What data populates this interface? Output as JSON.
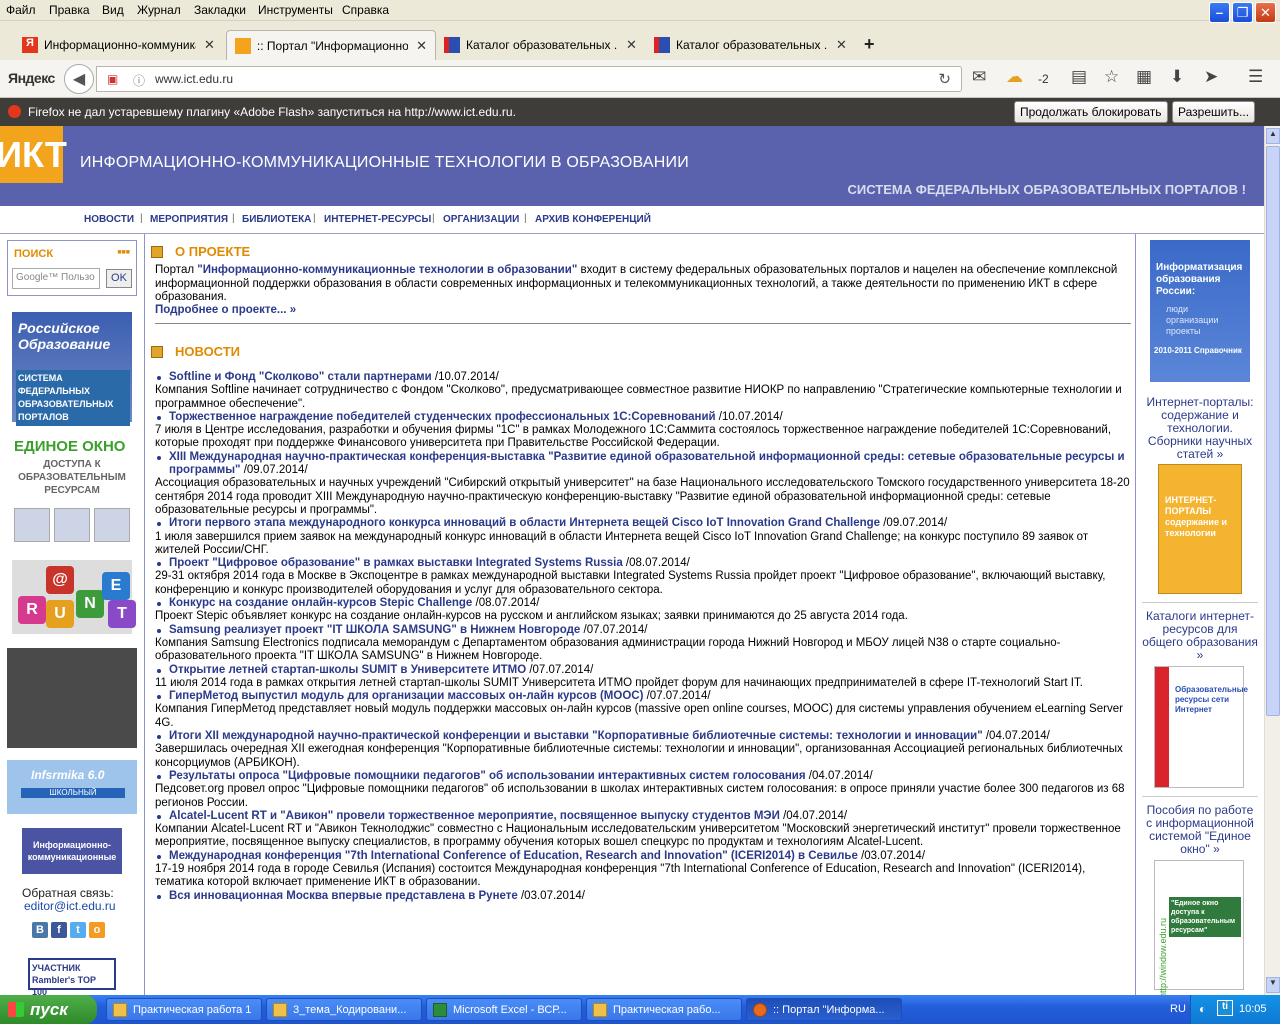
{
  "menubar": [
    "Файл",
    "Правка",
    "Вид",
    "Журнал",
    "Закладки",
    "Инструменты",
    "Справка"
  ],
  "tabs": [
    {
      "title": "Информационно-коммуника...",
      "active": false
    },
    {
      "title": ":: Портал \"Информационно-...",
      "active": true
    },
    {
      "title": "Каталог образовательных ...",
      "active": false
    },
    {
      "title": "Каталог образовательных ...",
      "active": false
    }
  ],
  "navbar": {
    "brand": "Яндекс",
    "url": "www.ict.edu.ru",
    "weather": "-2"
  },
  "notification": {
    "text": "Firefox не дал устаревшему плагину «Adobe Flash» запуститься на http://www.ict.edu.ru.",
    "block_label": "Продолжать блокировать",
    "allow_label": "Разрешить..."
  },
  "site": {
    "logo": "ИКТ",
    "title": "ИНФОРМАЦИОННО-КОММУНИКАЦИОННЫЕ ТЕХНОЛОГИИ В ОБРАЗОВАНИИ",
    "subtitle": "СИСТЕМА ФЕДЕРАЛЬНЫХ ОБРАЗОВАТЕЛЬНЫХ ПОРТАЛОВ !",
    "nav": [
      "НОВОСТИ",
      "МЕРОПРИЯТИЯ",
      "БИБЛИОТЕКА",
      "ИНТЕРНЕТ-РЕСУРСЫ",
      "ОРГАНИЗАЦИИ",
      "АРХИВ КОНФЕРЕНЦИЙ"
    ]
  },
  "left": {
    "search_label": "ПОИСК",
    "search_placeholder": "Google™ Пользо",
    "ok_label": "OK",
    "ro_title": "Российское Образование",
    "ro_sub": "СИСТЕМА ФЕДЕРАЛЬНЫХ ОБРАЗОВАТЕЛЬНЫХ ПОРТАЛОВ",
    "eo_title": "ЕДИНОЕ ОКНО",
    "eo_sub": "ДОСТУПА К ОБРАЗОВАТЕЛЬНЫМ РЕСУРСАМ",
    "runet": [
      "R",
      "U",
      "N",
      "E",
      "T",
      "@"
    ],
    "inf_title": "Infsrmika 6.0",
    "inf_sub": "ШКОЛЬНЫЙ",
    "ikt_banner": "Информационно-коммуникационные",
    "feedback_label": "Обратная связь:",
    "feedback_email": "editor@ict.edu.ru",
    "social": [
      "В",
      "f",
      "t",
      "o"
    ],
    "rambler": "УЧАСТНИК Rambler's TOP 100"
  },
  "about": {
    "heading": "О ПРОЕКТЕ",
    "pre": "Портал ",
    "link": "\"Информационно-коммуникационные технологии в образовании\"",
    "post": " входит в систему федеральных образовательных порталов и нацелен на обеспечение комплексной информационной поддержки образования в области современных информационных и телекоммуникационных технологий, а также деятельности по применению ИКТ в сфере образования.",
    "more": "Подробнее о проекте... »"
  },
  "news_heading": "НОВОСТИ",
  "news": [
    {
      "title": "Softline и Фонд \"Сколково\" стали партнерами",
      "date": " /10.07.2014/",
      "desc": "Компания Softline начинает сотрудничество с Фондом \"Сколково\", предусматривающее совместное развитие НИОКР по направлению \"Стратегические компьютерные технологии и программное обеспечение\"."
    },
    {
      "title": "Торжественное награждение победителей студенческих профессиональных 1С:Соревнований",
      "date": " /10.07.2014/",
      "desc": "7 июля в Центре исследования, разработки и обучения фирмы \"1С\" в рамках Молодежного 1С:Саммита состоялось торжественное награждение победителей 1С:Соревнований, которые проходят при поддержке Финансового университета при Правительстве Российской Федерации."
    },
    {
      "title": "XIII Международная научно-практическая конференция-выставка \"Развитие единой образовательной информационной среды: сетевые образовательные ресурсы и программы\"",
      "date": " /09.07.2014/",
      "desc": "Ассоциация образовательных и научных учреждений \"Сибирский открытый университет\" на базе Национального исследовательского Томского государственного университета 18-20 сентября 2014 года проводит XIII Международную научно-практическую конференцию-выставку \"Развитие единой образовательной информационной среды: сетевые образовательные ресурсы и программы\"."
    },
    {
      "title": "Итоги первого этапа международного конкурса инноваций в области Интернета вещей Cisco IoT Innovation Grand Challenge",
      "date": " /09.07.2014/",
      "desc": "1 июля завершился прием заявок на международный конкурс инноваций в области Интернета вещей Cisco IoT Innovation Grand Challenge; на конкурс поступило 89 заявок от жителей России/СНГ."
    },
    {
      "title": "Проект \"Цифровое образование\" в рамках выставки Integrated Systems Russia",
      "date": " /08.07.2014/",
      "desc": "29-31 октября 2014 года в Москве в Экспоцентре в рамках международной выставки Integrated Systems Russia пройдет проект \"Цифровое образование\", включающий выставку, конференцию и конкурс производителей оборудования и услуг для образовательного сектора."
    },
    {
      "title": "Конкурс на создание онлайн-курсов Stepic Challenge",
      "date": " /08.07.2014/",
      "desc": "Проект Stepic объявляет конкурс на создание онлайн-курсов на русском и английском языках; заявки принимаются до 25 августа 2014 года."
    },
    {
      "title": "Samsung реализует проект \"IT ШКОЛА SAMSUNG\" в Нижнем Новгороде",
      "date": " /07.07.2014/",
      "desc": "Компания Samsung Electronics подписала меморандум с Департаментом образования администрации города Нижний Новгород и МБОУ лицей N38 о старте социально-образовательного проекта \"IT ШКОЛА SAMSUNG\" в Нижнем Новгороде."
    },
    {
      "title": "Открытие летней стартап-школы SUMIT в Университете ИТМО",
      "date": " /07.07.2014/",
      "desc": "11 июля 2014 года в рамках открытия летней стартап-школы SUMIT Университета ИТМО пройдет форум для начинающих предпринимателей в сфере IT-технологий Start IT."
    },
    {
      "title": "ГиперМетод выпустил модуль для организации массовых он-лайн курсов (MOOC)",
      "date": " /07.07.2014/",
      "desc": "Компания ГиперМетод представляет новый модуль поддержки массовых он-лайн курсов (massive open online courses, MOOC) для системы управления обучением eLearning Server 4G."
    },
    {
      "title": "Итоги XII международной научно-практической конференции и выставки \"Корпоративные библиотечные системы: технологии и инновации\"",
      "date": " /04.07.2014/",
      "desc": "Завершилась очередная XII ежегодная конференция \"Корпоративные библиотечные системы: технологии и инновации\", организованная Ассоциацией региональных библиотечных консорциумов (АРБИКОН)."
    },
    {
      "title": "Результаты опроса \"Цифровые помощники педагогов\" об использовании интерактивных систем голосования",
      "date": " /04.07.2014/",
      "desc": "Педсовет.org провел опрос \"Цифровые помощники педагогов\" об использовании в школах интерактивных систем голосования: в опросе приняли участие более 300 педагогов из 68 регионов России."
    },
    {
      "title": "Alcatel-Lucent RT и \"Авикон\" провели торжественное мероприятие, посвященное выпуску студентов МЭИ",
      "date": " /04.07.2014/",
      "desc": "Компании Alcatel-Lucent RT и \"Авикон Текнолоджис\" совместно с Национальным исследовательским университетом \"Московский энергетический институт\" провели торжественное мероприятие, посвященное выпуску специалистов, в программу обучения которых вошел спецкурс по продуктам и технологиям Alcatel-Lucent."
    },
    {
      "title": "Международная конференция \"7th International Conference of Education, Research and Innovation\" (ICERI2014) в Севилье",
      "date": " /03.07.2014/",
      "desc": "17-19 ноября 2014 года в городе Севилья (Испания) состоится Международная конференция \"7th International Conference of Education, Research and Innovation\" (ICERI2014), тематика которой включает применение ИКТ в образовании."
    },
    {
      "title": "Вся инновационная Москва впервые представлена в Рунете",
      "date": " /03.07.2014/",
      "desc": ""
    }
  ],
  "right": {
    "book1_title": "Информатизация образования России:",
    "book1_sub": "люди организации проекты",
    "book1_year": "2010-2011 Справочник",
    "link1": "Интернет-порталы: содержание и технологии. Сборники научных статей »",
    "book2_title": "ИНТЕРНЕТ-ПОРТАЛЫ содержание и технологии",
    "link2": "Каталоги интернет-ресурсов для общего образования »",
    "book3_title": "Образовательные ресурсы сети Интернет",
    "link3": "Пособия по работе с информационной системой \"Единое окно\" »",
    "book4_title": "\"Единое окно доступа к образовательным ресурсам\"",
    "book4_side": "http://window.edu.ru"
  },
  "taskbar": {
    "start": "пуск",
    "tasks": [
      "Практическая работа 1",
      "3_тема_Кодировани...",
      "Microsoft Excel - ВСР...",
      "Практическая рабо...",
      ":: Портал \"Информа..."
    ],
    "lang": "RU",
    "clock": "10:05"
  },
  "colors": {
    "header_bg": "#5a62ae",
    "logo_bg": "#f2a51c",
    "link": "#2b3a8a",
    "section_heading": "#e08a00",
    "taskbar": "#245edb"
  }
}
